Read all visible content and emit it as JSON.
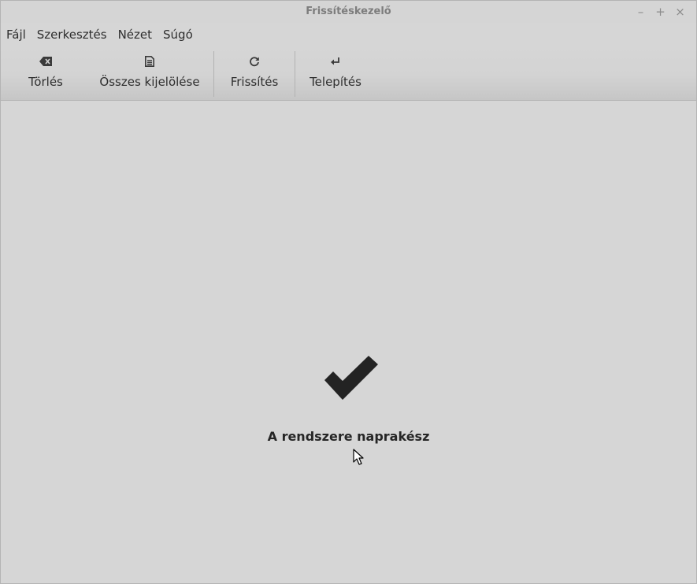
{
  "window": {
    "title": "Frissítéskezelő",
    "controls": {
      "minimize": "–",
      "maximize": "+",
      "close": "×"
    }
  },
  "menubar": {
    "items": [
      "Fájl",
      "Szerkesztés",
      "Nézet",
      "Súgó"
    ]
  },
  "toolbar": {
    "clear": {
      "label": "Törlés",
      "icon": "backspace-icon"
    },
    "select_all": {
      "label": "Összes kijelölése",
      "icon": "document-icon"
    },
    "refresh": {
      "label": "Frissítés",
      "icon": "refresh-icon"
    },
    "install": {
      "label": "Telepítés",
      "icon": "enter-return-icon"
    }
  },
  "status": {
    "icon": "checkmark-icon",
    "message": "A rendszere naprakész"
  }
}
